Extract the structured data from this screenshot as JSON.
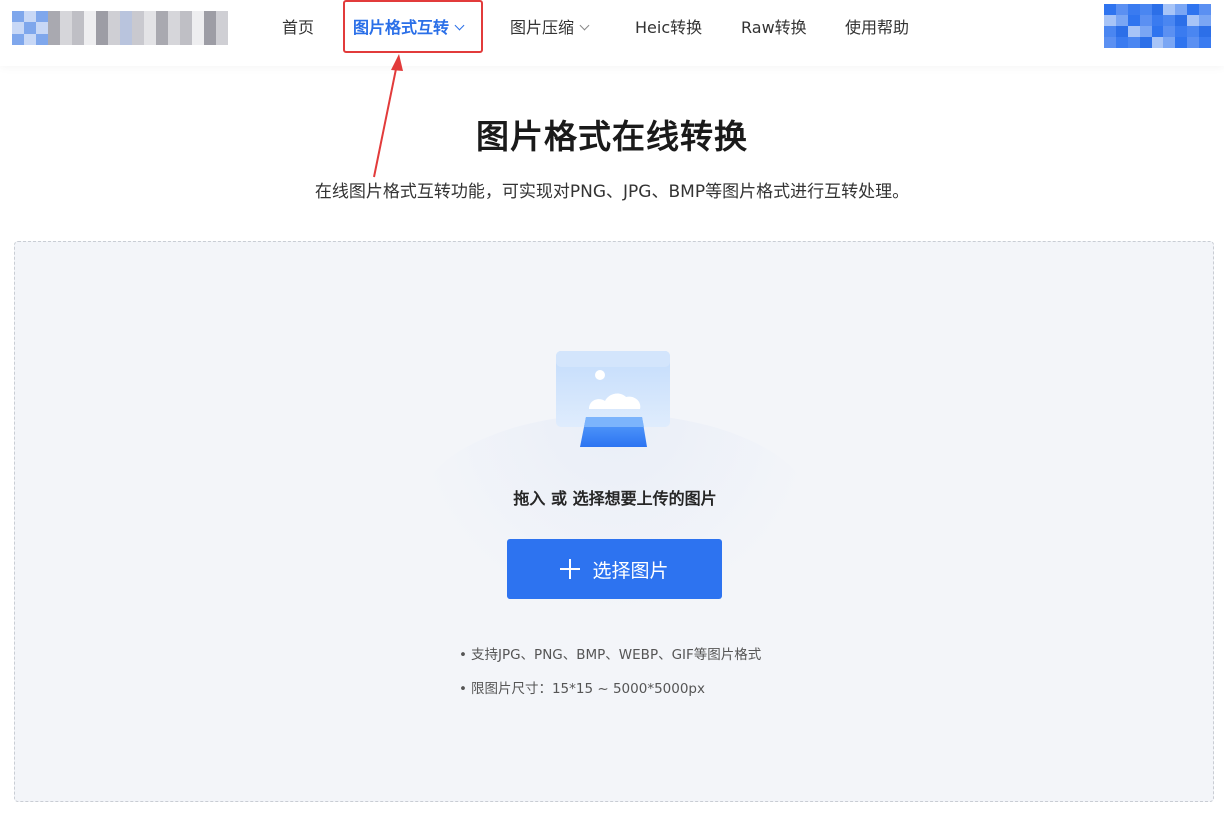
{
  "header": {
    "nav": [
      {
        "label": "首页",
        "dropdown": false,
        "active": false
      },
      {
        "label": "图片格式互转",
        "dropdown": true,
        "active": true
      },
      {
        "label": "图片压缩",
        "dropdown": true,
        "active": false
      },
      {
        "label": "Heic转换",
        "dropdown": false,
        "active": false
      },
      {
        "label": "Raw转换",
        "dropdown": false,
        "active": false
      },
      {
        "label": "使用帮助",
        "dropdown": false,
        "active": false
      }
    ]
  },
  "hero": {
    "title": "图片格式在线转换",
    "subtitle": "在线图片格式互转功能，可实现对PNG、JPG、BMP等图片格式进行互转处理。"
  },
  "upload": {
    "prompt": "拖入 或 选择想要上传的图片",
    "button_label": "选择图片",
    "tips": [
      "支持JPG、PNG、BMP、WEBP、GIF等图片格式",
      "限图片尺寸：15*15 ~ 5000*5000px"
    ]
  },
  "colors": {
    "accent": "#2d73f0",
    "active_nav": "#2a6fe8",
    "annotation": "#e23b3b",
    "upload_bg": "#f3f5f9"
  },
  "icons": [
    "chevron-down-icon",
    "image-upload-illustration",
    "plus-icon",
    "annotation-arrow"
  ]
}
